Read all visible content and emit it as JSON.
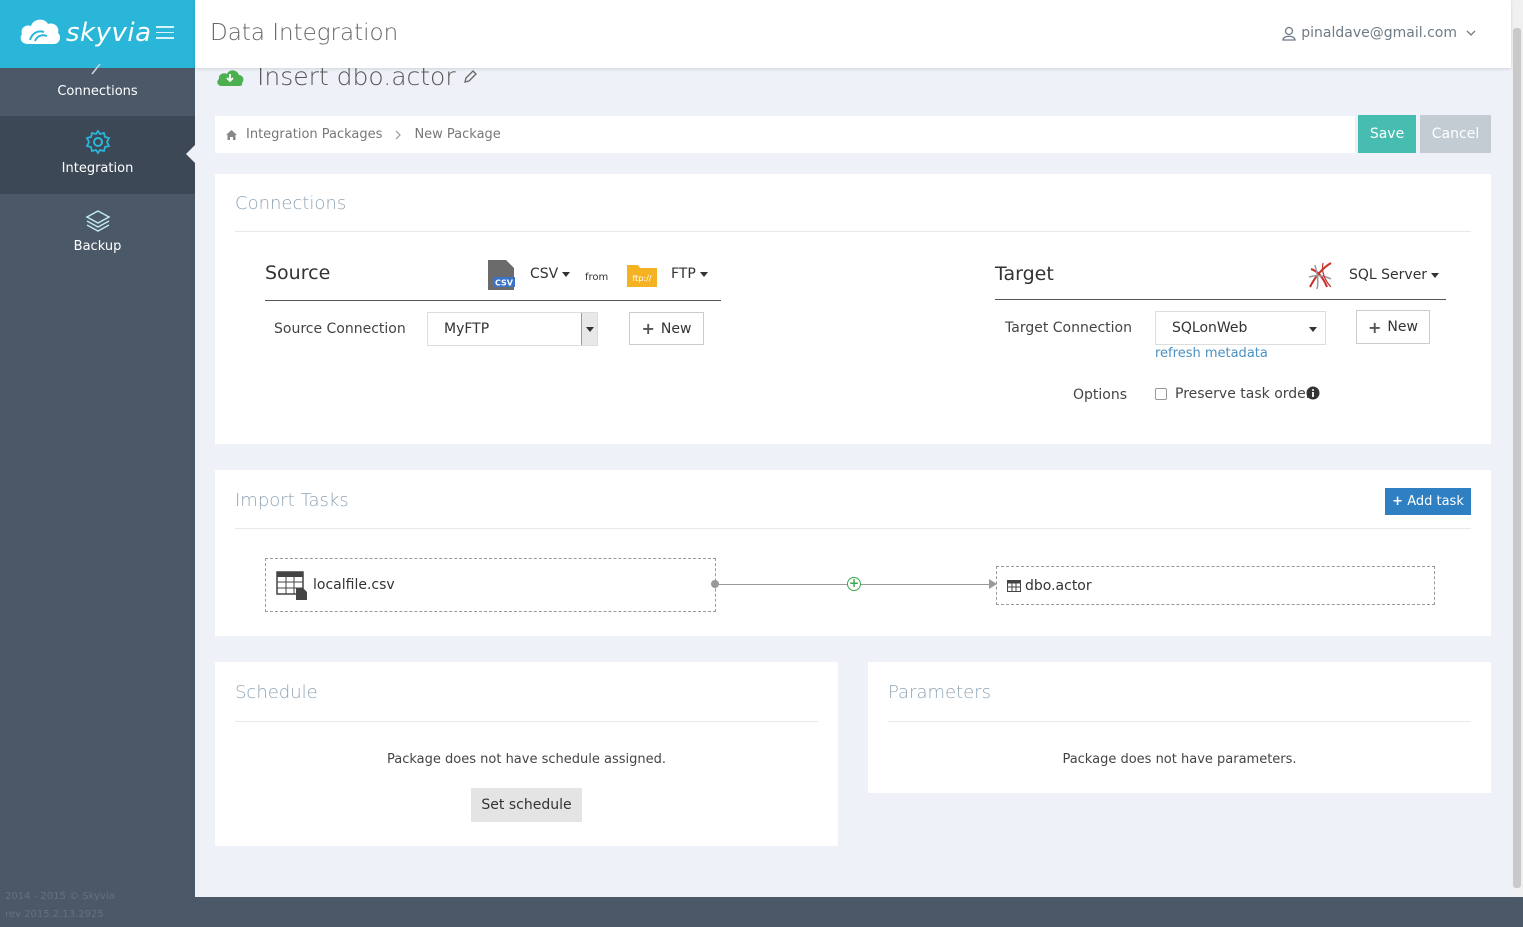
{
  "app": {
    "logo_text": "skyvia",
    "header_title": "Data Integration",
    "user_email": "pinaldave@gmail.com",
    "brand_color": "#29b6d8"
  },
  "sidebar": {
    "items": [
      {
        "label": "Connections",
        "icon": "pencil-icon"
      },
      {
        "label": "Integration",
        "icon": "gear-icon",
        "active": true
      },
      {
        "label": "Backup",
        "icon": "layers-icon"
      }
    ],
    "copyright": "2014 - 2015 © Skyvia",
    "revision": "rev 2015.2.13.2925"
  },
  "page": {
    "title": "Insert dbo.actor"
  },
  "breadcrumb": {
    "items": [
      "Integration Packages",
      "New Package"
    ]
  },
  "actions": {
    "save": "Save",
    "cancel": "Cancel"
  },
  "connections": {
    "title": "Connections",
    "source": {
      "heading": "Source",
      "format": "CSV",
      "from": "from",
      "protocol": "FTP",
      "connection_label": "Source Connection",
      "connection_value": "MyFTP",
      "new_label": "New",
      "csv_icon_text": "CSV",
      "ftp_icon_text": "ftp://"
    },
    "target": {
      "heading": "Target",
      "type": "SQL Server",
      "connection_label": "Target Connection",
      "connection_value": "SQLonWeb",
      "new_label": "New",
      "refresh_link": "refresh metadata",
      "options_label": "Options",
      "preserve_label": "Preserve task order",
      "preserve_checked": false
    }
  },
  "import_tasks": {
    "title": "Import Tasks",
    "add_task": "Add task",
    "source_item": "localfile.csv",
    "target_item": "dbo.actor"
  },
  "schedule": {
    "title": "Schedule",
    "message": "Package does not have schedule assigned.",
    "button": "Set schedule"
  },
  "parameters": {
    "title": "Parameters",
    "message": "Package does not have parameters."
  }
}
